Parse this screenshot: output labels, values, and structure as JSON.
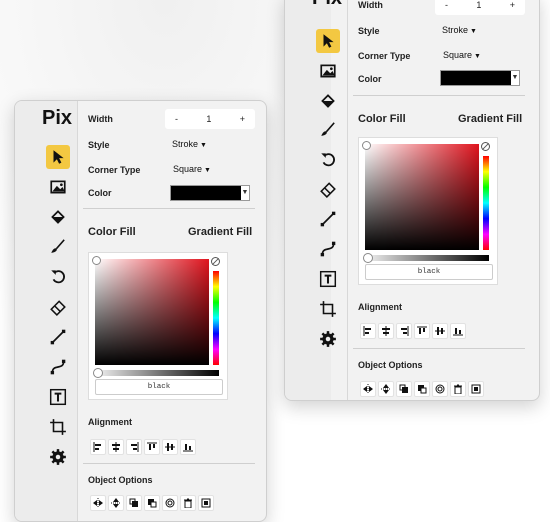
{
  "app": {
    "logo": "Pix"
  },
  "props": {
    "width_label": "Width",
    "width_minus": "-",
    "width_value": "1",
    "width_plus": "+",
    "style_label": "Style",
    "style_value": "Stroke",
    "corner_label": "Corner Type",
    "corner_value": "Square",
    "color_label": "Color",
    "color_value": "#000000"
  },
  "fill": {
    "color_fill_label": "Color Fill",
    "gradient_fill_label": "Gradient Fill",
    "hex_value": "black"
  },
  "alignment": {
    "label": "Alignment"
  },
  "object_options": {
    "label": "Object Options"
  },
  "tools": [
    "select-tool",
    "image-tool",
    "fill-tool",
    "brush-tool",
    "undo-tool",
    "eraser-tool",
    "line-tool",
    "curve-tool",
    "text-tool",
    "crop-tool",
    "settings-tool"
  ],
  "colors": {
    "accent": "#f3c842",
    "picker_red": "#e0141e",
    "panel_bg": "#f2f2f2"
  }
}
